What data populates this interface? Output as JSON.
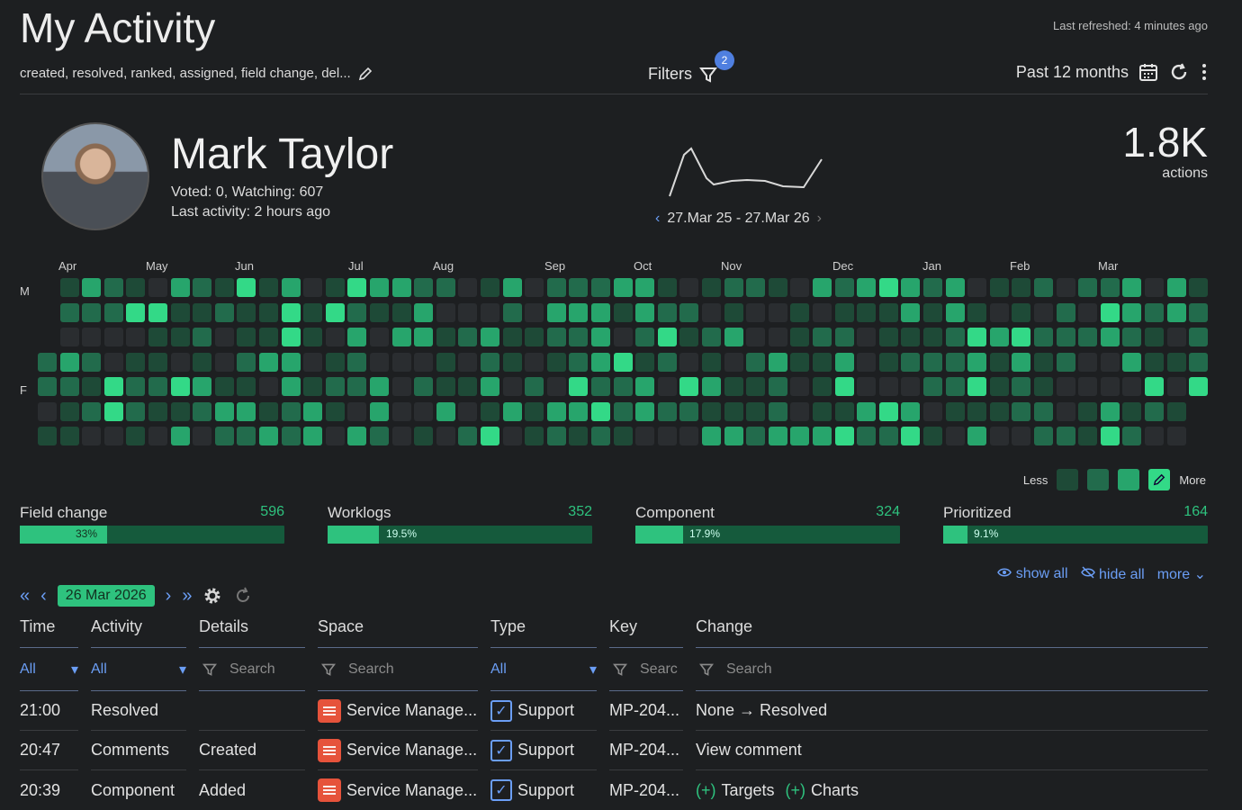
{
  "header": {
    "title": "My Activity",
    "last_refreshed": "Last refreshed: 4 minutes ago",
    "subtitle": "created, resolved, ranked, assigned, field change, del...",
    "filters_label": "Filters",
    "filters_count": "2",
    "period": "Past 12 months"
  },
  "profile": {
    "name": "Mark Taylor",
    "voted_watching": "Voted: 0, Watching: 607",
    "last_activity": "Last activity: 2 hours ago",
    "date_range": "27.Mar 25 - 27.Mar 26",
    "total": "1.8K",
    "total_label": "actions"
  },
  "heatmap": {
    "months": [
      "Apr",
      "May",
      "Jun",
      "Jul",
      "Aug",
      "Sep",
      "Oct",
      "Nov",
      "Dec",
      "Jan",
      "Feb",
      "Mar"
    ],
    "day_labels": [
      "M",
      "F"
    ],
    "legend_less": "Less",
    "legend_more": "More",
    "colors": [
      "#2a2d30",
      "#1e4a37",
      "#226b4c",
      "#27a56c",
      "#33d987"
    ]
  },
  "stats": [
    {
      "label": "Field change",
      "value": "596",
      "pct": "33%",
      "fraction": 0.33
    },
    {
      "label": "Worklogs",
      "value": "352",
      "pct": "19.5%",
      "fraction": 0.195
    },
    {
      "label": "Component",
      "value": "324",
      "pct": "17.9%",
      "fraction": 0.179
    },
    {
      "label": "Prioritized",
      "value": "164",
      "pct": "9.1%",
      "fraction": 0.091
    }
  ],
  "links": {
    "show_all": "show all",
    "hide_all": "hide all",
    "more": "more"
  },
  "toolbar": {
    "date": "26 Mar 2026"
  },
  "table": {
    "columns": {
      "time": "Time",
      "activity": "Activity",
      "details": "Details",
      "space": "Space",
      "type": "Type",
      "key": "Key",
      "change": "Change"
    },
    "filters": {
      "time": "All",
      "activity": "All",
      "details": "Search",
      "space": "Search",
      "type": "All",
      "key": "Searc",
      "change": "Search"
    },
    "rows": [
      {
        "time": "21:00",
        "activity": "Resolved",
        "details": "",
        "space": "Service Manage...",
        "type": "Support",
        "key": "MP-204...",
        "change": "None → Resolved"
      },
      {
        "time": "20:47",
        "activity": "Comments",
        "details": "Created",
        "space": "Service Manage...",
        "type": "Support",
        "key": "MP-204...",
        "change": "View comment"
      },
      {
        "time": "20:39",
        "activity": "Component",
        "details": "Added",
        "space": "Service Manage...",
        "type": "Support",
        "key": "MP-204...",
        "change_a": "Targets",
        "change_b": "Charts",
        "plus": "(+)"
      }
    ]
  }
}
